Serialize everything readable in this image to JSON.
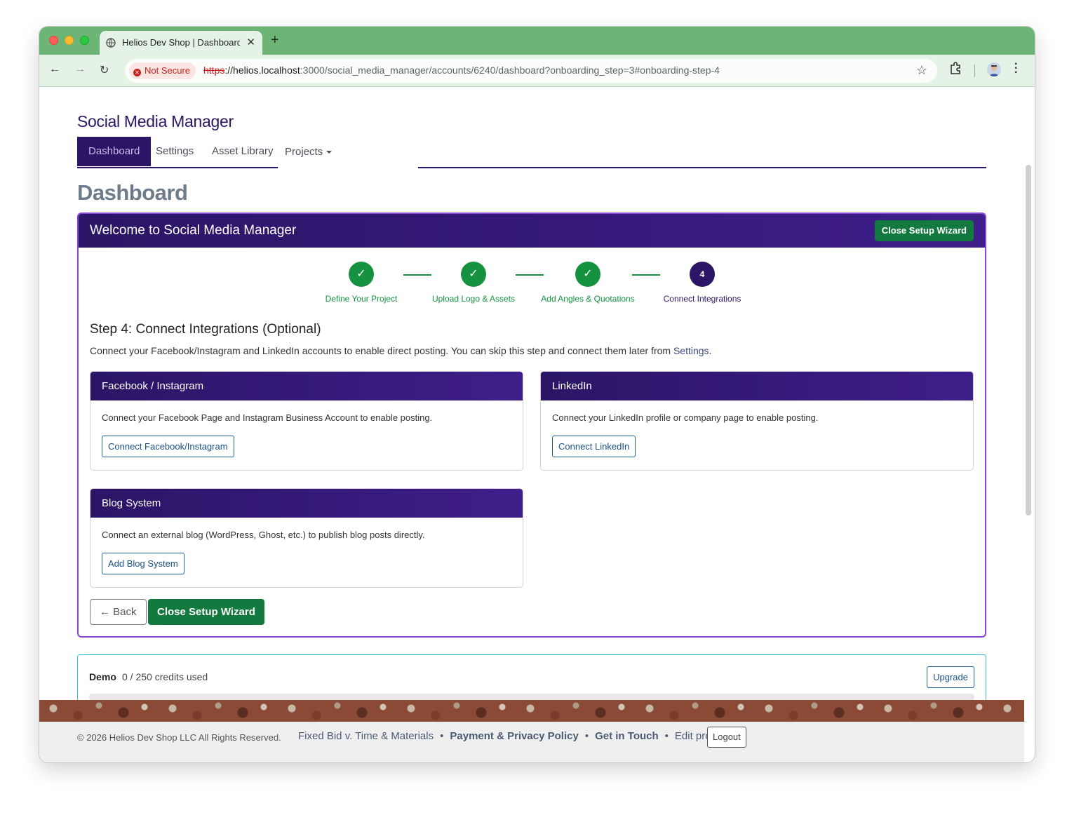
{
  "browser": {
    "tab_title": "Helios Dev Shop | Dashboard",
    "new_tab": "+",
    "security_badge": "Not Secure",
    "url_scheme": "https",
    "url_host": "://helios.localhost",
    "url_path": ":3000/social_media_manager/accounts/6240/dashboard?onboarding_step=3#onboarding-step-4"
  },
  "app": {
    "title": "Social Media Manager",
    "nav": {
      "dashboard": "Dashboard",
      "settings": "Settings",
      "asset_library": "Asset Library",
      "projects": "Projects"
    },
    "page_heading": "Dashboard"
  },
  "wizard": {
    "title": "Welcome to Social Media Manager",
    "close_label": "Close Setup Wizard",
    "steps": [
      {
        "label": "Define Your Project",
        "status": "complete",
        "mark": "✓"
      },
      {
        "label": "Upload Logo & Assets",
        "status": "complete",
        "mark": "✓"
      },
      {
        "label": "Add Angles & Quotations",
        "status": "complete",
        "mark": "✓"
      },
      {
        "label": "Connect Integrations",
        "status": "current",
        "mark": "4"
      }
    ],
    "step_heading": "Step 4: Connect Integrations (Optional)",
    "step_desc": "Connect your Facebook/Instagram and LinkedIn accounts to enable direct posting. You can skip this step and connect them later from ",
    "step_desc_link": "Settings",
    "step_desc_end": ".",
    "cards": {
      "facebook": {
        "title": "Facebook / Instagram",
        "body": "Connect your Facebook Page and Instagram Business Account to enable posting.",
        "button": "Connect Facebook/Instagram"
      },
      "linkedin": {
        "title": "LinkedIn",
        "body": "Connect your LinkedIn profile or company page to enable posting.",
        "button": "Connect LinkedIn"
      },
      "blog": {
        "title": "Blog System",
        "body": "Connect an external blog (WordPress, Ghost, etc.) to publish blog posts directly.",
        "button": "Add Blog System"
      }
    },
    "back_label": "← Back"
  },
  "plan": {
    "name": "Demo",
    "credits": "0 / 250 credits used",
    "credits_used_fraction": 0,
    "upgrade_label": "Upgrade"
  },
  "footer": {
    "copyright": "© 2026 Helios Dev Shop LLC All Rights Reserved.",
    "links": [
      "Fixed Bid v. Time & Materials",
      "Payment & Privacy Policy",
      "Get in Touch",
      "Edit profile"
    ],
    "separator": "•",
    "logout": "Logout"
  },
  "colors": {
    "brand": "#2a1566",
    "success": "#127a3f",
    "wizard_border": "#8b45d6",
    "tab_bar": "#6db477"
  }
}
